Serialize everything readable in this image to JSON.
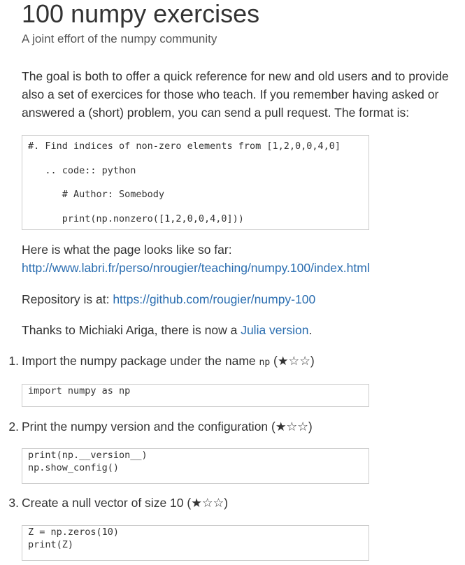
{
  "title": "100 numpy exercises",
  "subtitle": "A joint effort of the numpy community",
  "intro": "The goal is both to offer a quick reference for new and old users and to provide also a set of exercices for those who teach. If you remember having asked or answered a (short) problem, you can send a pull request. The format is:",
  "format_code": [
    "#. Find indices of non-zero elements from [1,2,0,0,4,0]",
    "   .. code:: python",
    "      # Author: Somebody",
    "      print(np.nonzero([1,2,0,0,4,0]))"
  ],
  "page_preview": {
    "text": "Here is what the page looks like so far:",
    "link": "http://www.labri.fr/perso/nrougier/teaching/numpy.100/index.html"
  },
  "repository": {
    "text": "Repository is at: ",
    "link": "https://github.com/rougier/numpy-100"
  },
  "thanks": {
    "text": "Thanks to Michiaki Ariga, there is now a ",
    "link": "Julia version",
    "end": "."
  },
  "exercises": [
    {
      "number": "1.",
      "text_before": "Import the numpy package under the name ",
      "inline_code": "np",
      "rating": " (★☆☆)",
      "code": "import numpy as np"
    },
    {
      "number": "2.",
      "text_before": "Print the numpy version and the configuration",
      "inline_code": "",
      "rating": " (★☆☆)",
      "code": "print(np.__version__)\nnp.show_config()"
    },
    {
      "number": "3.",
      "text_before": "Create a null vector of size 10",
      "inline_code": "",
      "rating": " (★☆☆)",
      "code": "Z = np.zeros(10)\nprint(Z)"
    }
  ]
}
